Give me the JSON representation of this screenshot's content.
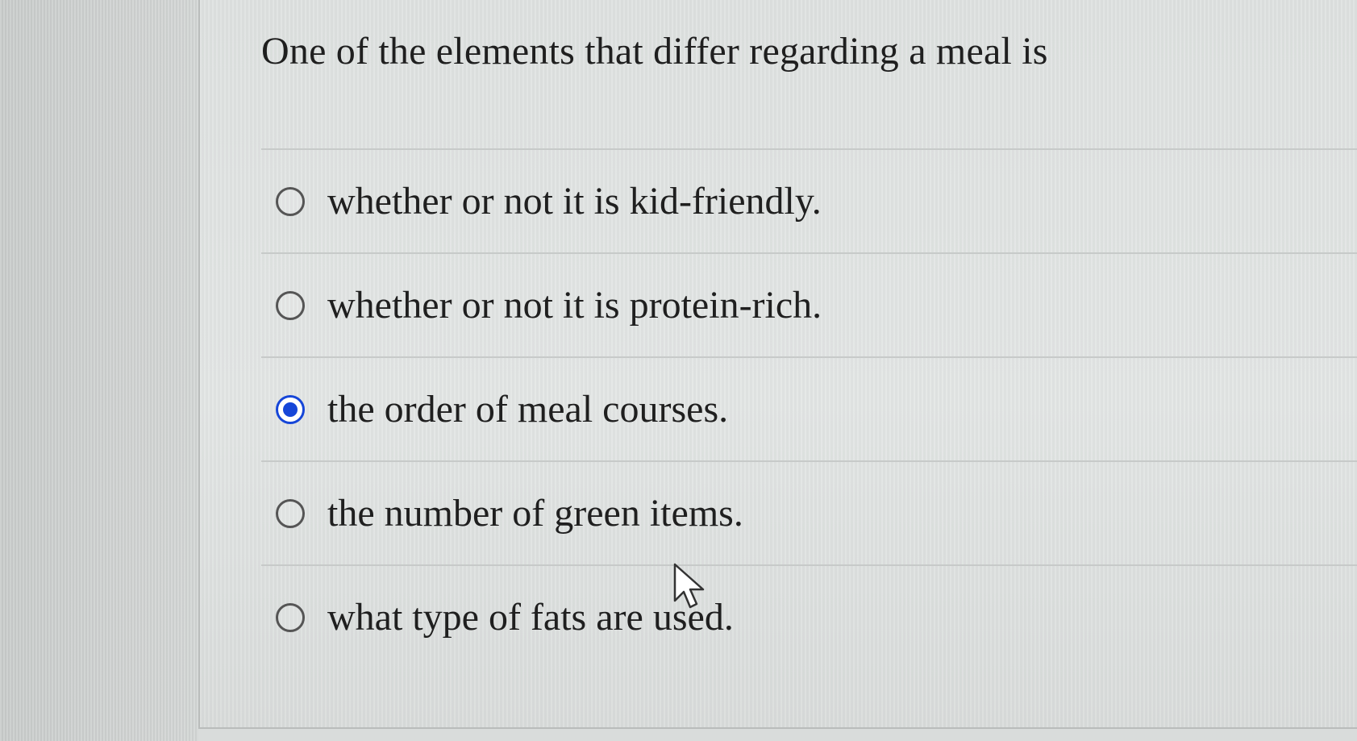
{
  "question": {
    "text": "One of the elements that differ regarding a meal is"
  },
  "options": [
    {
      "label": "whether or not it is kid-friendly.",
      "selected": false
    },
    {
      "label": "whether or not it is protein-rich.",
      "selected": false
    },
    {
      "label": "the order of meal courses.",
      "selected": true
    },
    {
      "label": "the number of green items.",
      "selected": false
    },
    {
      "label": "what type of fats are used.",
      "selected": false
    }
  ],
  "selected_option_index": 2,
  "colors": {
    "radio_selected": "#1646d8",
    "radio_unselected": "#555555",
    "background": "#e0e3e2",
    "divider": "#c7cac9",
    "text": "#1f1f1f"
  },
  "icons": {
    "pointer": "mouse-pointer-icon",
    "radio": "radio-button-icon"
  }
}
